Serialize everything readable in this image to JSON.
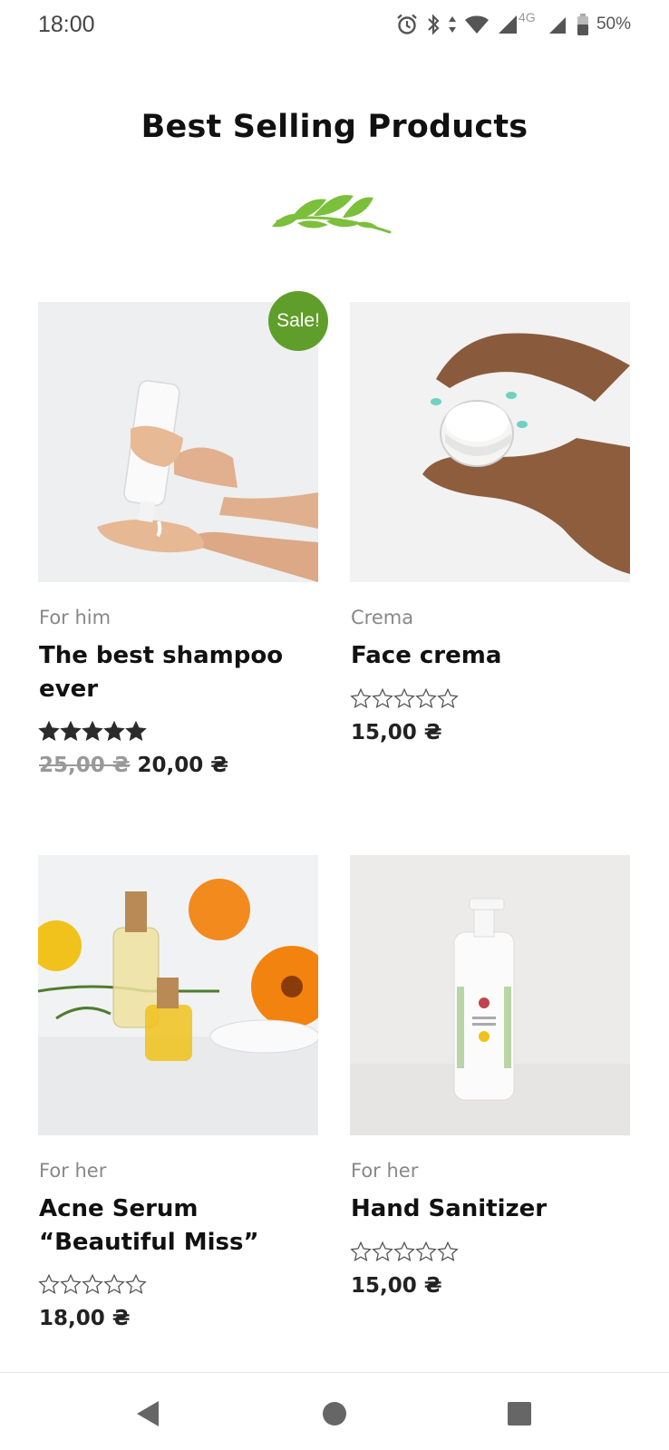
{
  "status_bar": {
    "time": "18:00",
    "battery_percent": "50%",
    "network_label": "4G",
    "icons": [
      "alarm-icon",
      "bluetooth-icon",
      "data-arrows-icon",
      "wifi-icon",
      "signal-icon",
      "signal-icon",
      "battery-icon"
    ]
  },
  "section": {
    "title": "Best Selling Products",
    "decor_icon": "leaf-branch-icon",
    "accent_color": "#7bbf3a"
  },
  "products": [
    {
      "category": "For him",
      "title": "The best shampoo ever",
      "rating": 5,
      "max_rating": 5,
      "on_sale": true,
      "sale_label": "Sale!",
      "old_price": "25,00 ₴",
      "price": "20,00 ₴",
      "image": "hands-dispensing-shampoo-photo"
    },
    {
      "category": "Crema",
      "title": "Face crema",
      "rating": 0,
      "max_rating": 5,
      "on_sale": false,
      "price": "15,00 ₴",
      "image": "hands-holding-cream-jar-photo"
    },
    {
      "category": "For her",
      "title": "Acne Serum “Beautiful Miss”",
      "rating": 0,
      "max_rating": 5,
      "on_sale": false,
      "price": "18,00 ₴",
      "image": "serum-bottles-calendula-photo"
    },
    {
      "category": "For her",
      "title": "Hand Sanitizer",
      "rating": 0,
      "max_rating": 5,
      "on_sale": false,
      "price": "15,00 ₴",
      "image": "sanitizer-pump-bottle-photo"
    }
  ],
  "nav_bar": {
    "icons": [
      "back-icon",
      "home-icon",
      "recents-icon"
    ]
  },
  "colors": {
    "sale_badge": "#5f9e2a",
    "text_primary": "#111111",
    "text_muted": "#888888"
  }
}
